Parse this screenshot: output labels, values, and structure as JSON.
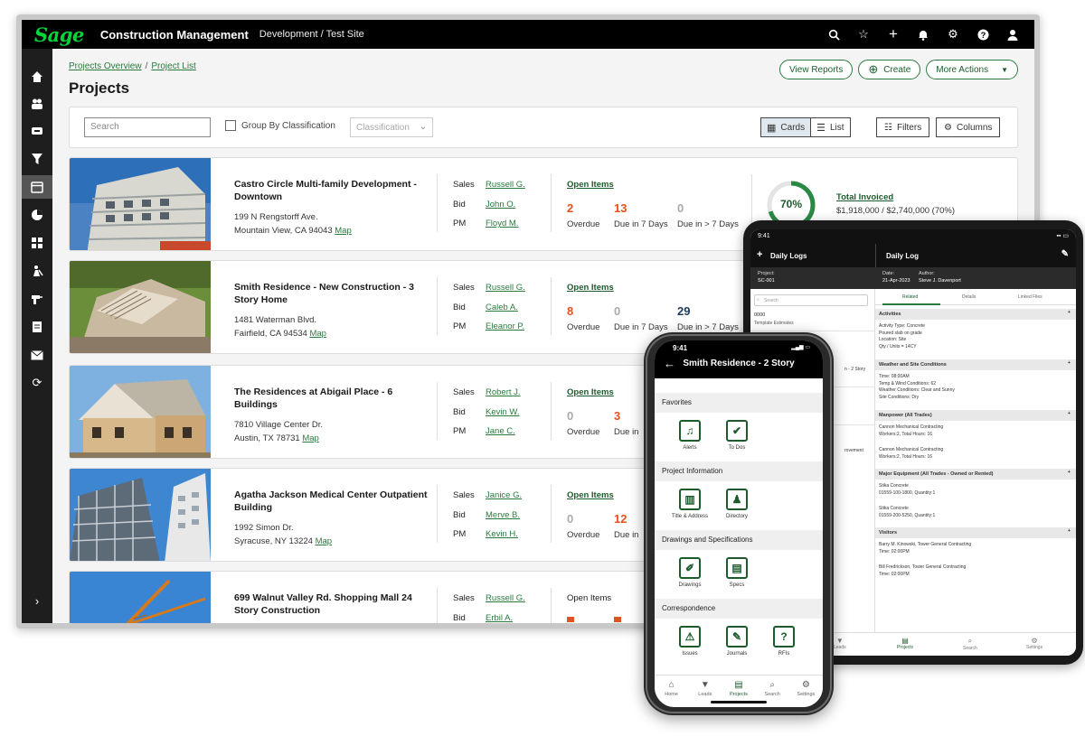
{
  "app": {
    "logo": "Sage",
    "title": "Construction Management",
    "site": "Development / Test Site"
  },
  "breadcrumb": {
    "item1": "Projects Overview",
    "sep": "/",
    "item2": "Project List"
  },
  "page_title": "Projects",
  "header_buttons": {
    "view_reports": "View Reports",
    "create": "Create",
    "more_actions": "More Actions"
  },
  "filters": {
    "search_placeholder": "Search",
    "group_by": "Group By Classification",
    "classification": "Classification",
    "cards": "Cards",
    "list": "List",
    "filters": "Filters",
    "columns": "Columns"
  },
  "projects": [
    {
      "name": "Castro Circle Multi-family Development - Downtown",
      "street": "199 N Rengstorff Ave.",
      "city": "Mountain View, CA 94043",
      "map": "Map",
      "sales_label": "Sales",
      "sales": "Russell G.",
      "bid_label": "Bid",
      "bid": "John O.",
      "pm_label": "PM",
      "pm": "Floyd M.",
      "open_items": "Open Items",
      "overdue": "2",
      "overdue_label": "Overdue",
      "due7": "13",
      "due7_label": "Due in 7 Days",
      "due_gt7": "0",
      "due_gt7_label": "Due in > 7 Days",
      "invoice_pct": "70%",
      "invoice_fraction": 0.7,
      "total_invoiced_label": "Total Invoiced",
      "total_invoiced": "$1,918,000 / $2,740,000 (70%)"
    },
    {
      "name": "Smith Residence - New Construction - 3 Story Home",
      "street": "1481 Waterman Blvd.",
      "city": "Fairfield, CA 94534",
      "map": "Map",
      "sales_label": "Sales",
      "sales": "Russell G.",
      "bid_label": "Bid",
      "bid": "Caleb A.",
      "pm_label": "PM",
      "pm": "Eleanor P.",
      "open_items": "Open Items",
      "overdue": "8",
      "overdue_label": "Overdue",
      "due7": "0",
      "due7_label": "Due in 7 Days",
      "due_gt7": "29",
      "due_gt7_label": "Due in > 7 Days"
    },
    {
      "name": "The Residences at Abigail Place - 6 Buildings",
      "street": "7810 Village Center Dr.",
      "city": "Austin, TX 78731",
      "map": "Map",
      "sales_label": "Sales",
      "sales": "Robert J.",
      "bid_label": "Bid",
      "bid": "Kevin W.",
      "pm_label": "PM",
      "pm": "Jane C.",
      "open_items": "Open Items",
      "overdue": "0",
      "overdue_label": "Overdue",
      "due7": "3",
      "due7_label": "Due in"
    },
    {
      "name": "Agatha Jackson Medical Center Outpatient Building",
      "street": "1992 Simon Dr.",
      "city": "Syracuse, NY 13224",
      "map": "Map",
      "sales_label": "Sales",
      "sales": "Janice G.",
      "bid_label": "Bid",
      "bid": "Merve B.",
      "pm_label": "PM",
      "pm": "Kevin H.",
      "open_items": "Open Items",
      "overdue": "0",
      "overdue_label": "Overdue",
      "due7": "12",
      "due7_label": "Due in"
    },
    {
      "name": "699 Walnut Valley Rd. Shopping Mall 24 Story Construction",
      "sales_label": "Sales",
      "sales": "Russell G.",
      "bid_label": "Bid",
      "bid": "Erbil A.",
      "open_items": "Open Items"
    }
  ],
  "tablet": {
    "time": "9:41",
    "left_title": "Daily Logs",
    "right_title": "Daily Log",
    "project_label": "Project:",
    "project_value": "SC-001",
    "date_label": "Date:",
    "date_value": "21-Apr-2023",
    "author_label": "Author:",
    "author_value": "Steve J. Davenport",
    "search": "Search",
    "list_code": "0000",
    "list_name": "Template Estimates",
    "list_snippet1": "n - 2 Story",
    "list_snippet2": "rovement",
    "tabs": [
      "Related",
      "Details",
      "Linked Files"
    ],
    "sections": [
      {
        "title": "Activities",
        "lines": [
          "Activity Type: Concrete",
          "Poured slab on grade",
          "Location: Site",
          "Qty / Units = 14CY"
        ]
      },
      {
        "title": "Weather and Site Conditions",
        "lines": [
          "Time: 08:00AM",
          "Temp & Wind Conditions: 62",
          "Weather Conditions: Clear and Sunny",
          "Site Conditions: Dry"
        ]
      },
      {
        "title": "Manpower (All Trades)",
        "lines": [
          "Cannon Mechanical Contracting",
          "Workers:2, Total Hours: 16",
          "",
          "Cannon Mechanical Contracting",
          "Workers:2, Total Hours: 16"
        ]
      },
      {
        "title": "Major Equipment (All Trades - Owned or Rented)",
        "lines": [
          "Stika Concrete",
          "01559-100-1800, Quantity:1",
          "",
          "Stika Concrete",
          "01559-200-5250, Quantity:1"
        ]
      },
      {
        "title": "Visitors",
        "lines": [
          "Barry M. Kinowski, Tower General Contracting",
          "Time: 02:00PM",
          "",
          "Bill Fredrickson, Tower General Contracting",
          "Time: 02:00PM"
        ]
      }
    ],
    "nav": [
      "Leads",
      "Projects",
      "Search",
      "Settings"
    ]
  },
  "phone": {
    "time": "9:41",
    "title": "Smith Residence - 2 Story",
    "sections": [
      "Favorites",
      "Project Information",
      "Drawings and Specifications",
      "Correspondence"
    ],
    "tiles": {
      "alerts": "Alerts",
      "todos": "To Dos",
      "title_address": "Title & Address",
      "directory": "Directory",
      "drawings": "Drawings",
      "specs": "Specs",
      "issues": "Issues",
      "journals": "Journals",
      "rfis": "RFIs"
    },
    "nav": [
      "Home",
      "Leads",
      "Projects",
      "Search",
      "Settings"
    ]
  },
  "colors": {
    "brand_green": "#00d639",
    "accent_green": "#2a7a3e",
    "overdue_orange": "#e0521f",
    "navy": "#1d3a5e"
  }
}
